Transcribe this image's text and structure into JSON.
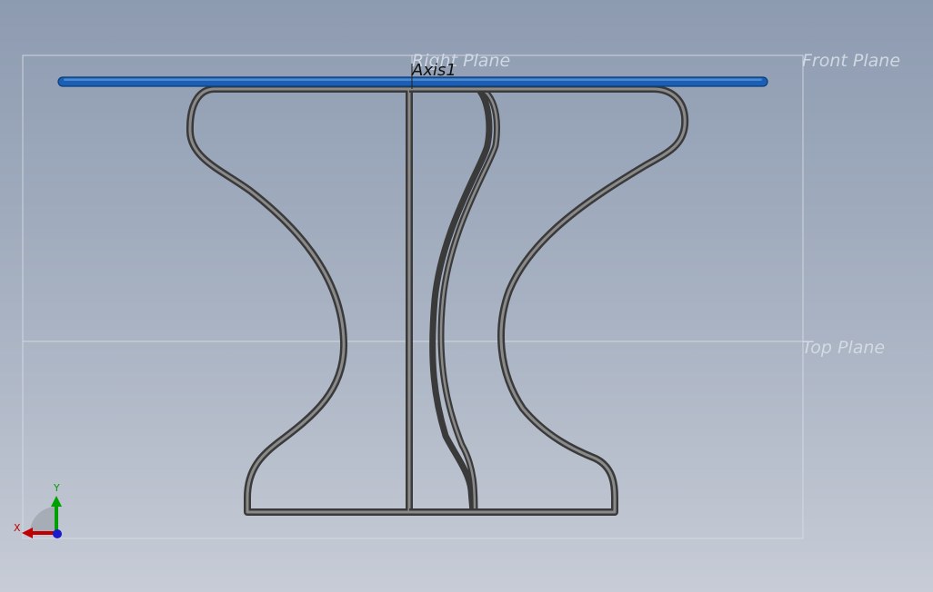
{
  "viewport": {
    "planes": {
      "right_plane": "Right Plane",
      "front_plane": "Front Plane",
      "top_plane": "Top Plane"
    },
    "axis_label": "Axis1"
  },
  "triad": {
    "x_label": "X",
    "y_label": "Y",
    "x_color": "#c00000",
    "y_color": "#00a000",
    "z_color": "#0000c0"
  },
  "model": {
    "table_top_color": "#1a5fb4",
    "leg_color": "#4a4a4a"
  }
}
